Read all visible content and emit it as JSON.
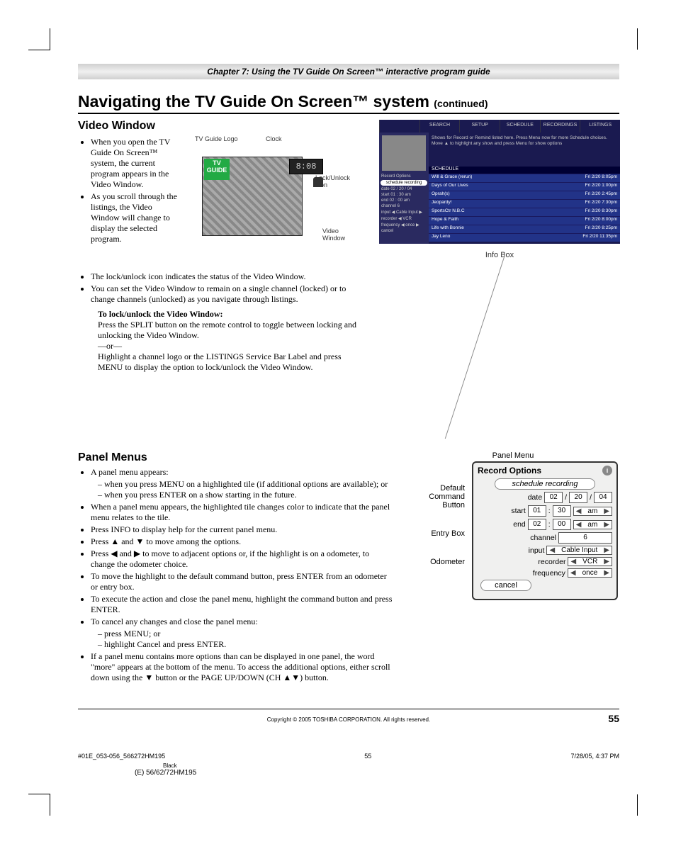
{
  "chapter": "Chapter 7: Using the TV Guide On Screen™ interactive program guide",
  "title_main": "Navigating the TV Guide On Screen™ system",
  "title_cont": "(continued)",
  "sections": {
    "video_window": {
      "heading": "Video Window",
      "b1": "When you open the TV Guide On Screen™ system, the current program appears in the Video Window.",
      "b2": "As you scroll through the listings, the Video Window will change to display the selected program.",
      "b3": "The lock/unlock icon indicates the status of the Video Window.",
      "b4": "You can set the Video Window to remain on a single channel (locked) or to change channels (unlocked) as you navigate through listings.",
      "lock_heading": "To lock/unlock the Video Window:",
      "lock_p1": "Press the SPLIT button on the remote control to toggle between locking and unlocking the Video Window.",
      "lock_or": "—or—",
      "lock_p2": "Highlight a channel logo or the LISTINGS Service Bar Label and press MENU to display the option to lock/unlock the Video Window."
    },
    "panel_menus": {
      "heading": "Panel Menus",
      "b1": "A panel menu appears:",
      "b1d1": "when you press MENU on a highlighted tile (if additional options are available); or",
      "b1d2": "when you press ENTER on a show starting in the future.",
      "b2": "When a panel menu appears, the highlighted tile changes color to indicate that the panel menu relates to the tile.",
      "b3": "Press INFO to display help for the current panel menu.",
      "b4": "Press ▲ and ▼ to move among the options.",
      "b5": "Press ◀ and ▶ to move to adjacent options or, if the highlight is on a odometer, to change the odometer choice.",
      "b6": "To move the highlight to the default command button, press ENTER from an odometer or entry box.",
      "b7": "To execute the action and close the panel menu, highlight the command button and press ENTER.",
      "b8": "To cancel any changes and close the panel menu:",
      "b8d1": "press MENU; or",
      "b8d2": "highlight Cancel and press ENTER.",
      "b9": "If a panel menu contains more options than can be displayed in one panel, the word \"more\" appears at the bottom of the menu. To access the additional options, either scroll down using the ▼ button or the PAGE UP/DOWN (CH ▲▼) button."
    }
  },
  "vw_illus": {
    "tv_guide_logo": "TV Guide Logo",
    "clock_label": "Clock",
    "clock_value": "8:08",
    "lock_label": "Lock/Unlock Icon",
    "video_label": "Video Window",
    "guide_logo_text": "TV GUIDE"
  },
  "sched": {
    "tabs": [
      "",
      "SEARCH",
      "SETUP",
      "SCHEDULE",
      "RECORDINGS",
      "LISTINGS"
    ],
    "info_tag": "Info",
    "msg": "Shows for Record or Remind listed here. Press Menu now for more Schedule choices. Move ▲ to highlight any show and press Menu for show options",
    "left_title": "Record Options",
    "left_cmd": "schedule recording",
    "left_items": [
      "date 02 / 20 / 04",
      "start 01 : 30  am",
      "end 02 : 00  am",
      "channel        6",
      "input ◀ Cable Input ▶",
      "recorder ◀  VCR",
      "frequency ◀ once ▶",
      "cancel"
    ],
    "rows": [
      {
        "t": "Will & Grace (rerun)",
        "d": "Fri 2/20  8:05pm"
      },
      {
        "t": "Days of Our Lives",
        "d": "Fri 2/20  1:00pm"
      },
      {
        "t": "Oprah(s)",
        "d": "Fri 2/20  2:45pm"
      },
      {
        "t": "Jeopardy!",
        "d": "Fri 2/20  7:30pm"
      },
      {
        "t": "SportsCtr N.B.C",
        "d": "Fri 2/20  8:30pm"
      },
      {
        "t": "Hope & Faith",
        "d": "Fri 2/20  8:00pm"
      },
      {
        "t": "Life with Bonnie",
        "d": "Fri 2/20  8:25pm"
      },
      {
        "t": "Jay Leno",
        "d": "Fri 2/20  11:35pm"
      }
    ],
    "section_header": "SCHEDULE",
    "info_box_label": "Info Box"
  },
  "panel_menu": {
    "overall_label": "Panel Menu",
    "side": {
      "default": "Default Command Button",
      "entry": "Entry Box",
      "odo": "Odometer"
    },
    "title": "Record Options",
    "cmd": "schedule recording",
    "date_lbl": "date",
    "date_m": "02",
    "date_d": "20",
    "date_y": "04",
    "start_lbl": "start",
    "start_h": "01",
    "start_m": "30",
    "start_ap": "am",
    "end_lbl": "end",
    "end_h": "02",
    "end_m": "00",
    "end_ap": "am",
    "channel_lbl": "channel",
    "channel_v": "6",
    "input_lbl": "input",
    "input_v": "Cable Input",
    "recorder_lbl": "recorder",
    "recorder_v": "VCR",
    "freq_lbl": "frequency",
    "freq_v": "once",
    "cancel": "cancel"
  },
  "footer": {
    "copyright": "Copyright © 2005 TOSHIBA CORPORATION. All rights reserved.",
    "page": "55",
    "meta_left": "#01E_053-056_566272HM195",
    "meta_mid": "55",
    "meta_right": "7/28/05, 4:37 PM",
    "black": "Black",
    "model": "(E) 56/62/72HM195"
  }
}
